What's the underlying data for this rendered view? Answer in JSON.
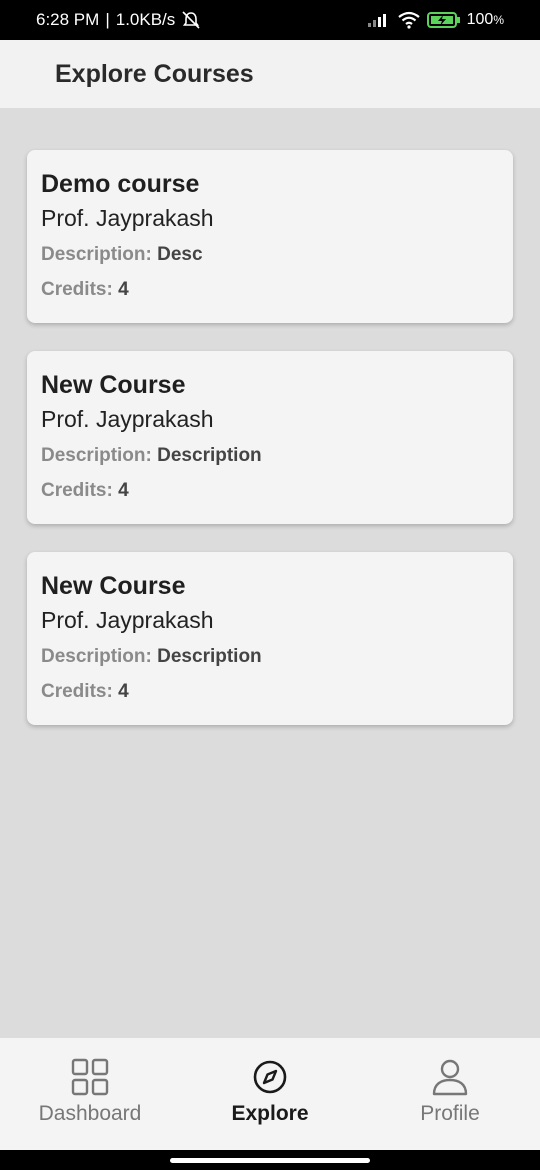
{
  "status_bar": {
    "time": "6:28 PM",
    "separator": "|",
    "net_speed": "1.0KB/s",
    "battery": "100",
    "battery_unit": "%"
  },
  "header": {
    "title": "Explore Courses"
  },
  "courses": [
    {
      "title": "Demo course",
      "professor": "Prof. Jayprakash",
      "description_label": "Description:",
      "description": "Desc",
      "credits_label": "Credits:",
      "credits": "4"
    },
    {
      "title": "New Course",
      "professor": "Prof. Jayprakash",
      "description_label": "Description:",
      "description": "Description",
      "credits_label": "Credits:",
      "credits": "4"
    },
    {
      "title": "New Course",
      "professor": "Prof. Jayprakash",
      "description_label": "Description:",
      "description": "Description",
      "credits_label": "Credits:",
      "credits": "4"
    }
  ],
  "bottom_nav": {
    "items": [
      {
        "label": "Dashboard",
        "icon": "grid-icon",
        "active": false
      },
      {
        "label": "Explore",
        "icon": "compass-icon",
        "active": true
      },
      {
        "label": "Profile",
        "icon": "person-icon",
        "active": false
      }
    ]
  }
}
